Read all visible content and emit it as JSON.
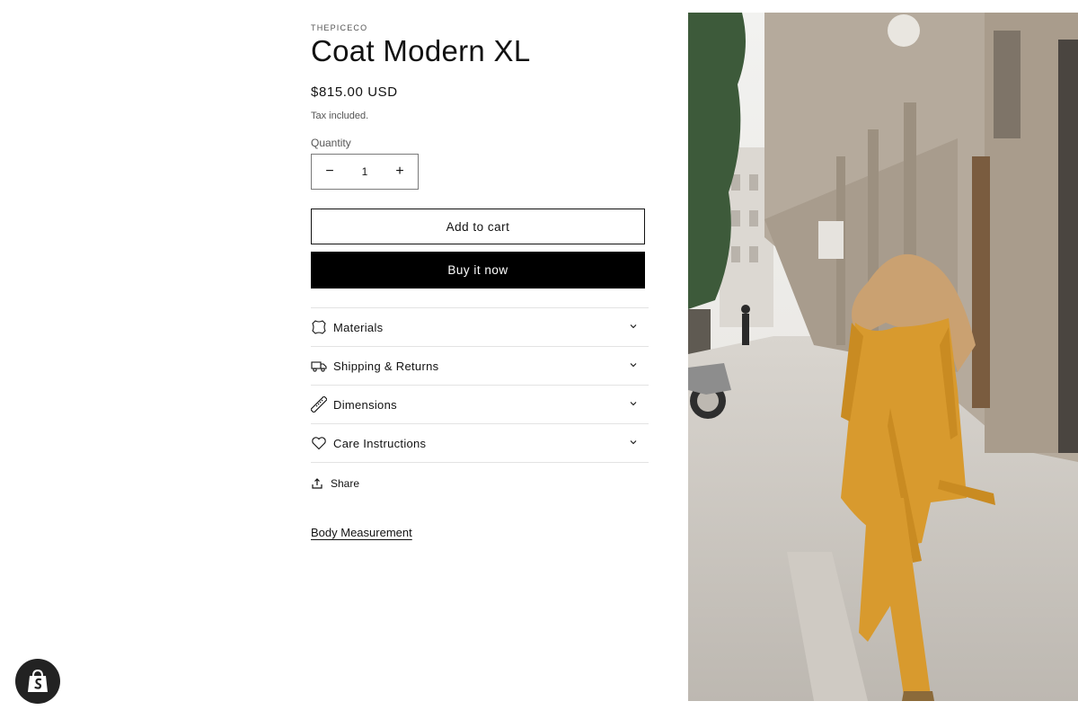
{
  "product": {
    "vendor": "THEPICECO",
    "title": "Coat Modern XL",
    "price": "$815.00 USD",
    "tax_note": "Tax included.",
    "quantity_label": "Quantity",
    "quantity_value": "1",
    "decrease_symbol": "−",
    "increase_symbol": "+",
    "add_to_cart_label": "Add to cart",
    "buy_now_label": "Buy it now"
  },
  "accordion": [
    {
      "label": "Materials",
      "icon": "leather-icon"
    },
    {
      "label": "Shipping & Returns",
      "icon": "truck-icon"
    },
    {
      "label": "Dimensions",
      "icon": "ruler-icon"
    },
    {
      "label": "Care Instructions",
      "icon": "heart-icon"
    }
  ],
  "share_label": "Share",
  "body_measurement_label": "Body Measurement",
  "colors": {
    "accent": "#000000",
    "coat": "#d89a2e",
    "shop_badge": "#222222"
  }
}
